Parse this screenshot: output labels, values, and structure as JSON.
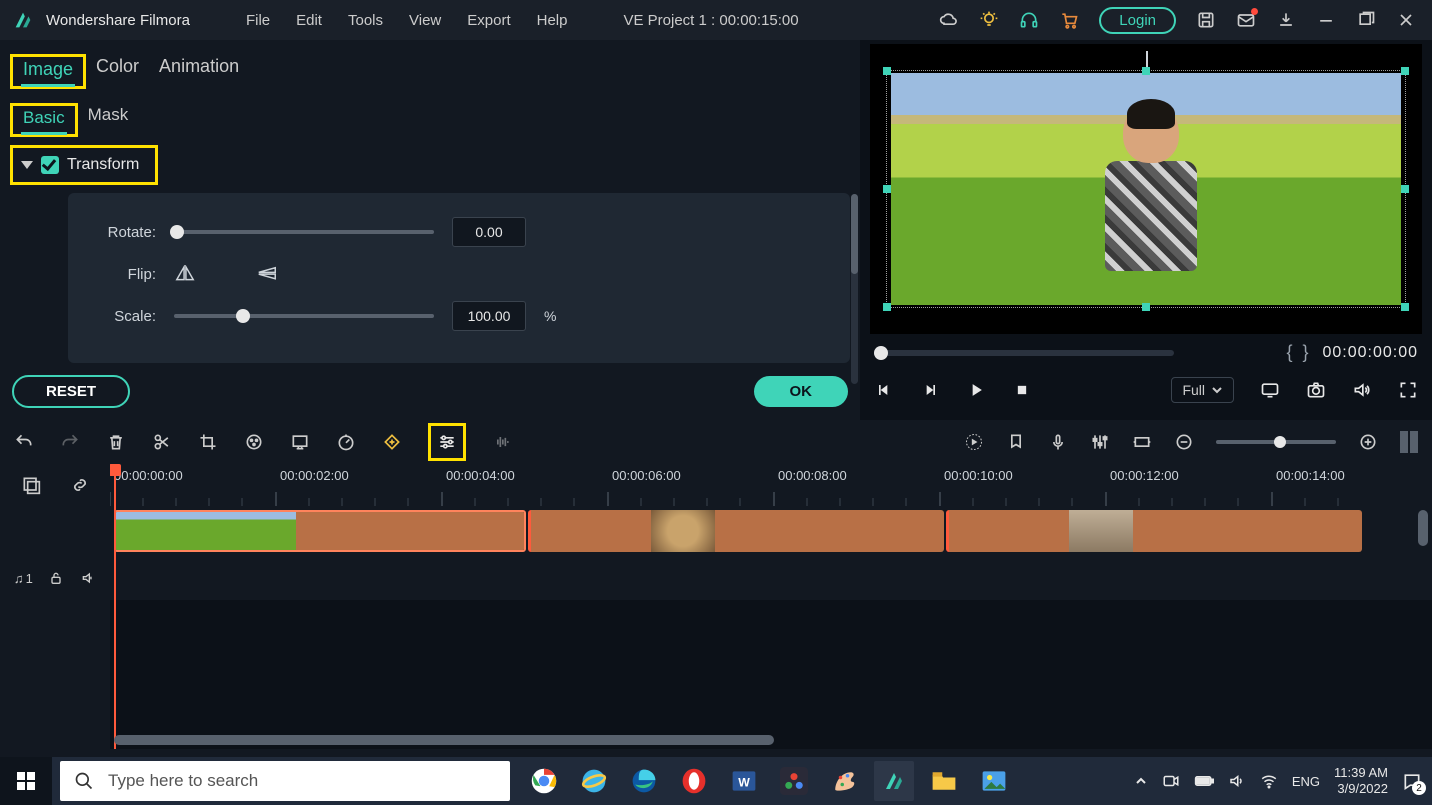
{
  "app": {
    "name": "Wondershare Filmora"
  },
  "menu": [
    "File",
    "Edit",
    "Tools",
    "View",
    "Export",
    "Help"
  ],
  "project_title": "VE Project 1 : 00:00:15:00",
  "login_label": "Login",
  "tabs1": {
    "image": "Image",
    "color": "Color",
    "animation": "Animation"
  },
  "tabs2": {
    "basic": "Basic",
    "mask": "Mask"
  },
  "transform": {
    "label": "Transform",
    "rotate_label": "Rotate:",
    "rotate_value": "0.00",
    "flip_label": "Flip:",
    "scale_label": "Scale:",
    "scale_value": "100.00",
    "scale_unit": "%"
  },
  "reset_label": "RESET",
  "ok_label": "OK",
  "preview": {
    "mark_in": "{",
    "mark_out": "}",
    "timecode": "00:00:00:00",
    "full_label": "Full"
  },
  "timeline": {
    "labels": [
      "00:00:00:00",
      "00:00:02:00",
      "00:00:04:00",
      "00:00:06:00",
      "00:00:08:00",
      "00:00:10:00",
      "00:00:12:00",
      "00:00:14:00"
    ],
    "audio_track_label": "1"
  },
  "search_placeholder": "Type here to search",
  "sys": {
    "lang": "ENG",
    "time": "11:39 AM",
    "date": "3/9/2022",
    "notif": "2"
  }
}
